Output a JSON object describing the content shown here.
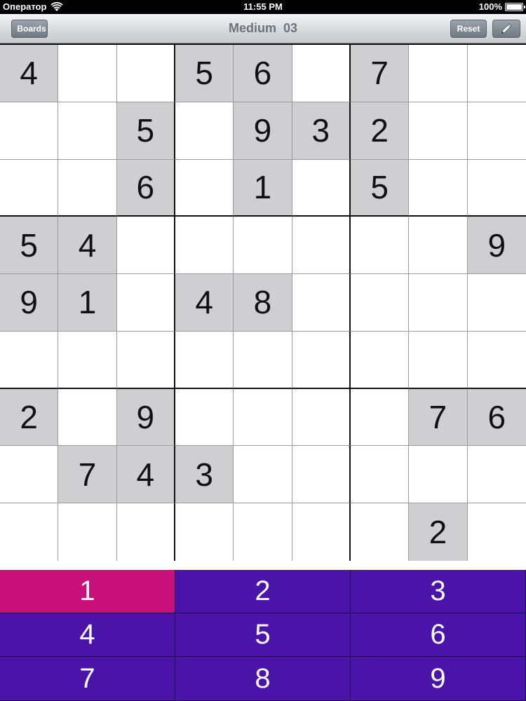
{
  "status_bar": {
    "carrier": "Оператор",
    "time": "11:55 PM",
    "battery": "100%"
  },
  "nav": {
    "back_label": "Boards",
    "title": "Medium  03",
    "reset_label": "Reset",
    "edit_icon": "pencil-icon"
  },
  "board": [
    [
      "4",
      "",
      "",
      "5",
      "6",
      "",
      "7",
      "",
      ""
    ],
    [
      "",
      "",
      "5",
      "",
      "9",
      "3",
      "2",
      "",
      ""
    ],
    [
      "",
      "",
      "6",
      "",
      "1",
      "",
      "5",
      "",
      ""
    ],
    [
      "5",
      "4",
      "",
      "",
      "",
      "",
      "",
      "",
      "9"
    ],
    [
      "9",
      "1",
      "",
      "4",
      "8",
      "",
      "",
      "",
      ""
    ],
    [
      "",
      "",
      "",
      "",
      "",
      "",
      "",
      "",
      ""
    ],
    [
      "2",
      "",
      "9",
      "",
      "",
      "",
      "",
      "7",
      "6"
    ],
    [
      "",
      "7",
      "4",
      "3",
      "",
      "",
      "",
      "",
      ""
    ],
    [
      "",
      "",
      "",
      "",
      "",
      "",
      "",
      "2",
      ""
    ]
  ],
  "numpad": {
    "keys": [
      "1",
      "2",
      "3",
      "4",
      "5",
      "6",
      "7",
      "8",
      "9"
    ],
    "selected": "1"
  },
  "colors": {
    "numpad_bg": "#4a14a8",
    "numpad_selected": "#c8107a",
    "given_cell": "#cfcfd2"
  }
}
